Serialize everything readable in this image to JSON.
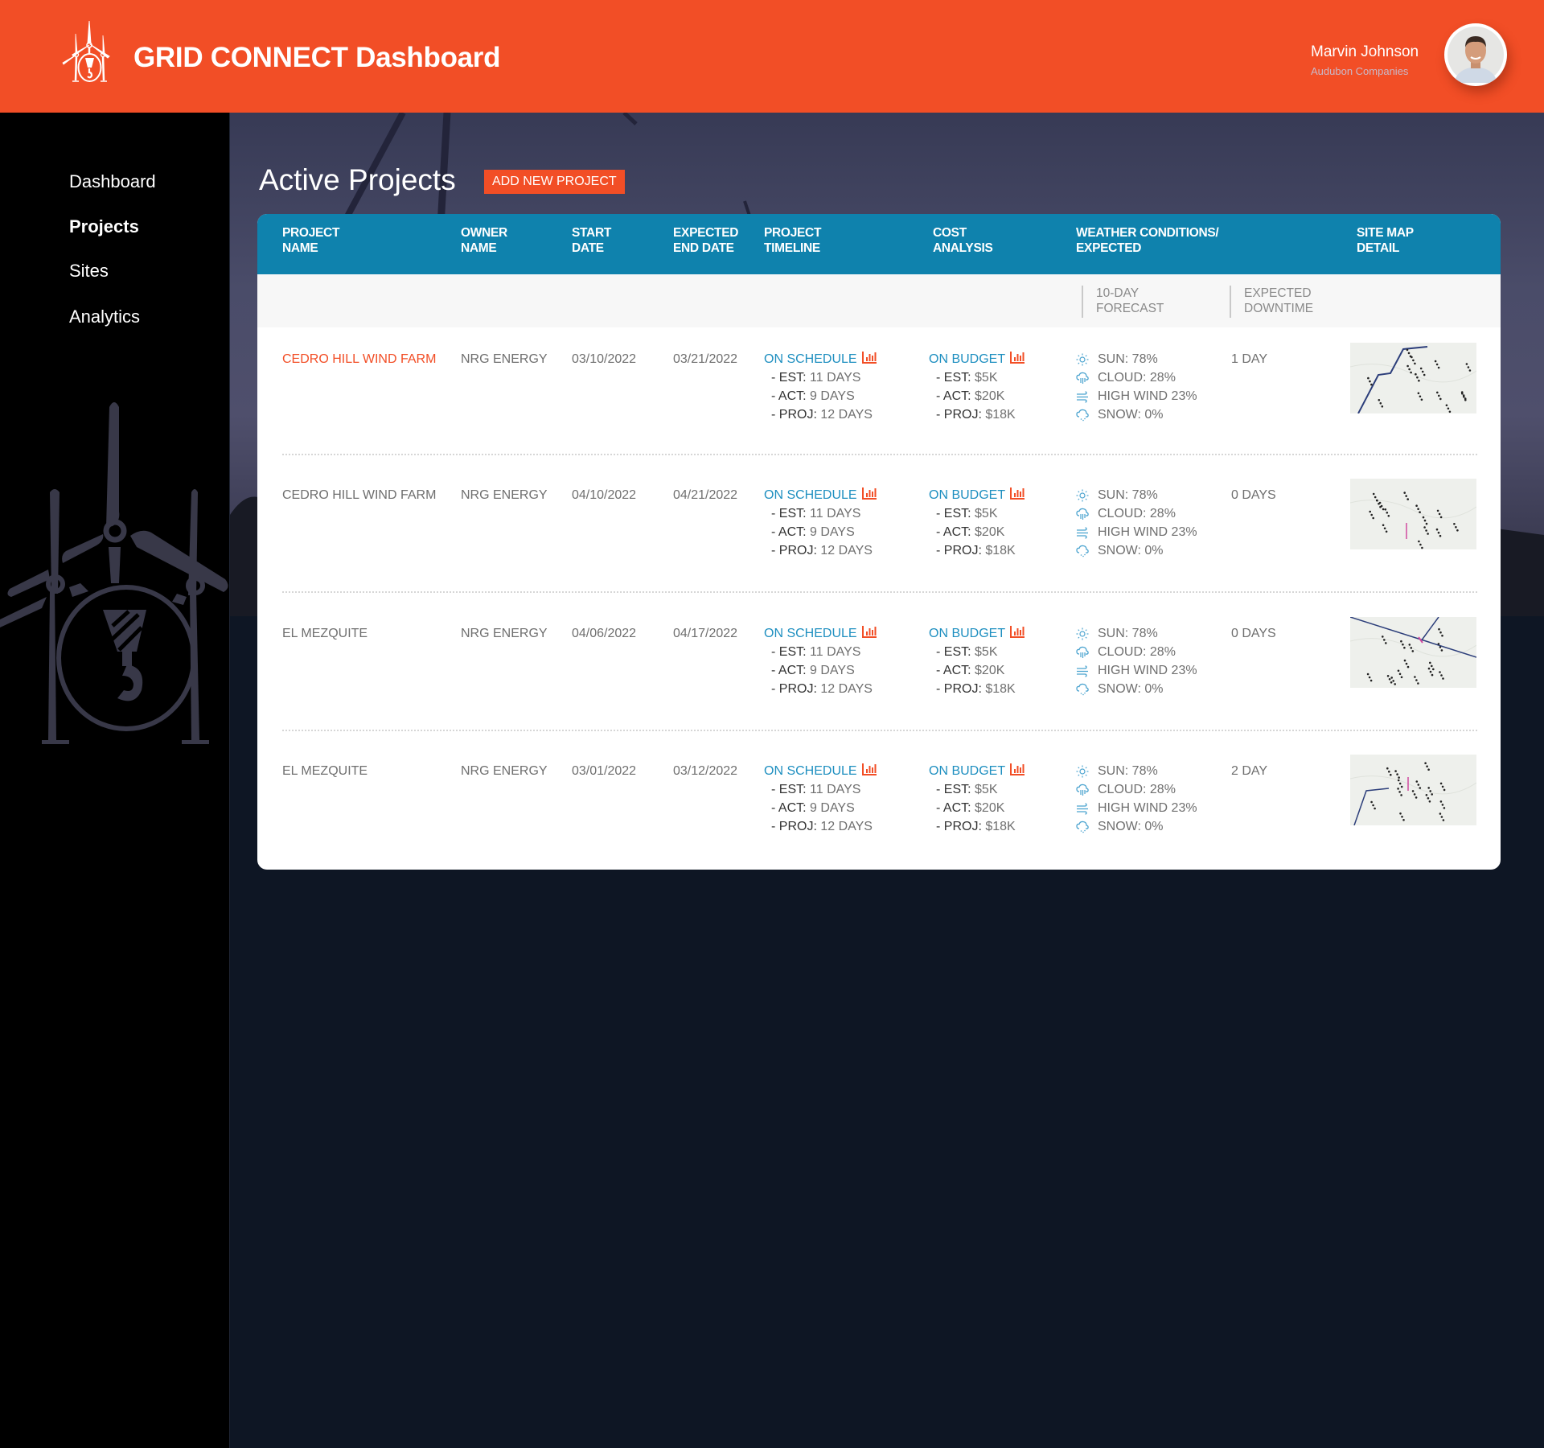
{
  "header": {
    "app_title": "GRID CONNECT Dashboard",
    "user_name": "Marvin Johnson",
    "user_company": "Audubon Companies",
    "accent_color": "#f24e26"
  },
  "sidebar": {
    "items": [
      {
        "label": "Dashboard",
        "active": false
      },
      {
        "label": "Projects",
        "active": true
      },
      {
        "label": "Sites",
        "active": false
      },
      {
        "label": "Analytics",
        "active": false
      }
    ]
  },
  "page": {
    "title": "Active Projects",
    "add_button_label": "ADD NEW PROJECT"
  },
  "table": {
    "header_color": "#0f82ad",
    "columns": [
      "PROJECT NAME",
      "OWNER NAME",
      "START DATE",
      "EXPECTED END DATE",
      "PROJECT TIMELINE",
      "COST ANALYSIS",
      "WEATHER CONDITIONS/ EXPECTED",
      "SITE MAP DETAIL"
    ],
    "column_lines": [
      [
        "PROJECT",
        "NAME"
      ],
      [
        "OWNER",
        "NAME"
      ],
      [
        "START",
        "DATE"
      ],
      [
        "EXPECTED",
        "END DATE"
      ],
      [
        "PROJECT",
        "TIMELINE"
      ],
      [
        "COST",
        "ANALYSIS"
      ],
      [
        "WEATHER CONDITIONS/",
        "EXPECTED"
      ],
      [
        "SITE MAP",
        "DETAIL"
      ]
    ],
    "subheaders": [
      [
        "10-DAY",
        "FORECAST"
      ],
      [
        "EXPECTED",
        "DOWNTIME"
      ]
    ],
    "rows": [
      {
        "project_name": "CEDRO HILL WIND FARM",
        "highlighted": true,
        "owner": "NRG ENERGY",
        "start_date": "03/10/2022",
        "end_date": "03/21/2022",
        "timeline_status": "ON SCHEDULE",
        "timeline": [
          {
            "label": "- EST:",
            "value": "11 DAYS"
          },
          {
            "label": "- ACT:",
            "value": "9 DAYS"
          },
          {
            "label": "- PROJ:",
            "value": "12 DAYS"
          }
        ],
        "cost_status": "ON BUDGET",
        "cost": [
          {
            "label": "- EST:",
            "value": "$5K"
          },
          {
            "label": "- ACT:",
            "value": "$20K"
          },
          {
            "label": "- PROJ:",
            "value": "$18K"
          }
        ],
        "weather": [
          {
            "icon": "sun-icon",
            "text": "SUN: 78%"
          },
          {
            "icon": "cloud-rain-icon",
            "text": "CLOUD: 28%"
          },
          {
            "icon": "wind-icon",
            "text": "HIGH WIND  23%"
          },
          {
            "icon": "snow-icon",
            "text": "SNOW: 0%"
          }
        ],
        "downtime": "1 DAY",
        "map_variant": 1
      },
      {
        "project_name": "CEDRO HILL WIND FARM",
        "highlighted": false,
        "owner": "NRG ENERGY",
        "start_date": "04/10/2022",
        "end_date": "04/21/2022",
        "timeline_status": "ON SCHEDULE",
        "timeline": [
          {
            "label": "- EST:",
            "value": "11 DAYS"
          },
          {
            "label": "- ACT:",
            "value": "9 DAYS"
          },
          {
            "label": "- PROJ:",
            "value": "12 DAYS"
          }
        ],
        "cost_status": "ON BUDGET",
        "cost": [
          {
            "label": "- EST:",
            "value": "$5K"
          },
          {
            "label": "- ACT:",
            "value": "$20K"
          },
          {
            "label": "- PROJ:",
            "value": "$18K"
          }
        ],
        "weather": [
          {
            "icon": "sun-icon",
            "text": "SUN: 78%"
          },
          {
            "icon": "cloud-rain-icon",
            "text": "CLOUD: 28%"
          },
          {
            "icon": "wind-icon",
            "text": "HIGH WIND  23%"
          },
          {
            "icon": "snow-icon",
            "text": "SNOW: 0%"
          }
        ],
        "downtime": "0 DAYS",
        "map_variant": 2
      },
      {
        "project_name": "EL MEZQUITE",
        "highlighted": false,
        "owner": "NRG ENERGY",
        "start_date": "04/06/2022",
        "end_date": "04/17/2022",
        "timeline_status": "ON SCHEDULE",
        "timeline": [
          {
            "label": "- EST:",
            "value": "11 DAYS"
          },
          {
            "label": "- ACT:",
            "value": "9 DAYS"
          },
          {
            "label": "- PROJ:",
            "value": "12 DAYS"
          }
        ],
        "cost_status": "ON BUDGET",
        "cost": [
          {
            "label": "- EST:",
            "value": "$5K"
          },
          {
            "label": "- ACT:",
            "value": "$20K"
          },
          {
            "label": "- PROJ:",
            "value": "$18K"
          }
        ],
        "weather": [
          {
            "icon": "sun-icon",
            "text": "SUN: 78%"
          },
          {
            "icon": "cloud-rain-icon",
            "text": "CLOUD: 28%"
          },
          {
            "icon": "wind-icon",
            "text": "HIGH WIND  23%"
          },
          {
            "icon": "snow-icon",
            "text": "SNOW: 0%"
          }
        ],
        "downtime": "0 DAYS",
        "map_variant": 3
      },
      {
        "project_name": "EL MEZQUITE",
        "highlighted": false,
        "owner": "NRG ENERGY",
        "start_date": "03/01/2022",
        "end_date": "03/12/2022",
        "timeline_status": "ON SCHEDULE",
        "timeline": [
          {
            "label": "- EST:",
            "value": "11 DAYS"
          },
          {
            "label": "- ACT:",
            "value": "9 DAYS"
          },
          {
            "label": "- PROJ:",
            "value": "12 DAYS"
          }
        ],
        "cost_status": "ON BUDGET",
        "cost": [
          {
            "label": "- EST:",
            "value": "$5K"
          },
          {
            "label": "- ACT:",
            "value": "$20K"
          },
          {
            "label": "- PROJ:",
            "value": "$18K"
          }
        ],
        "weather": [
          {
            "icon": "sun-icon",
            "text": "SUN: 78%"
          },
          {
            "icon": "cloud-rain-icon",
            "text": "CLOUD: 28%"
          },
          {
            "icon": "wind-icon",
            "text": "HIGH WIND  23%"
          },
          {
            "icon": "snow-icon",
            "text": "SNOW: 0%"
          }
        ],
        "downtime": "2 DAY",
        "map_variant": 4
      }
    ]
  }
}
